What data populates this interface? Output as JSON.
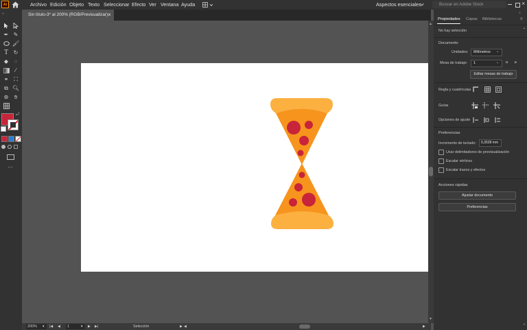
{
  "app": {
    "logo": "Ai",
    "home_icon": "home-icon"
  },
  "menu": [
    "Archivo",
    "Edición",
    "Objeto",
    "Texto",
    "Seleccionar",
    "Efecto",
    "Ver",
    "Ventana",
    "Ayuda"
  ],
  "workspace": {
    "label": "Aspectos esenciales",
    "search_placeholder": "Buscar en Adobe Stock"
  },
  "document_tab": {
    "title": "Sin título-3* al 200% (RGB/Previsualizar)",
    "close": "×"
  },
  "colors": {
    "fill": "#c8243a",
    "stroke": "#ffffff",
    "accent_orange": "#f7941d",
    "light_orange": "#fbb040",
    "pepperoni": "#c8243a"
  },
  "panel": {
    "tabs": [
      "Propiedades",
      "Capas",
      "Bibliotecas"
    ],
    "no_selection": "No hay selección",
    "document_title": "Documento",
    "units_label": "Unidades:",
    "units_value": "Milímetros",
    "artboard_label": "Mesa de trabajo:",
    "artboard_value": "1",
    "edit_artboards": "Editar mesas de trabajo",
    "rulers_grids": "Regla y cuadrículas",
    "guides": "Guías",
    "snap_options": "Opciones de ajuste",
    "preferences_title": "Preferencias",
    "keyboard_increment_label": "Incremento de teclado:",
    "keyboard_increment_value": "0,3528 mm",
    "checkbox_preview_bounds": "Usar delimitadores de previsualización",
    "checkbox_scale_corners": "Escalar vértices",
    "checkbox_scale_strokes": "Escalar trazos y efectos",
    "quick_actions_title": "Acciones rápidas",
    "fit_document": "Ajustar documento",
    "preferences_button": "Preferencias"
  },
  "status": {
    "zoom": "200%",
    "artboard": "1",
    "tool": "Selección"
  }
}
